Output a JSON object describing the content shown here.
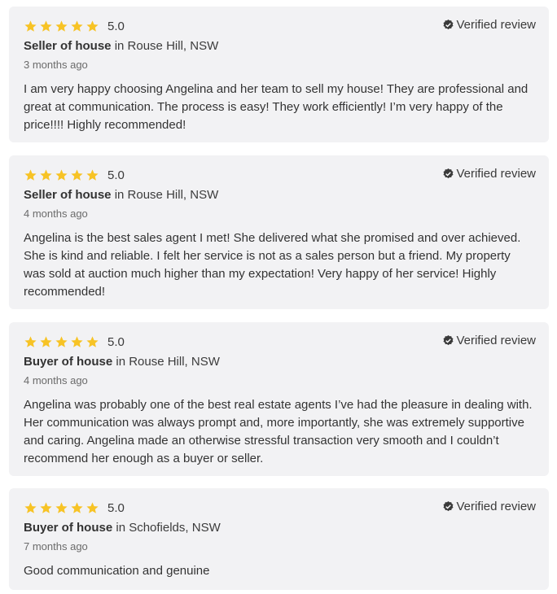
{
  "reviews": [
    {
      "rating": "5.0",
      "stars": 5,
      "verified_label": "Verified review",
      "role": "Seller of house",
      "location": " in Rouse Hill, NSW",
      "date": "3 months ago",
      "text": "I am very happy choosing Angelina and her team to sell my house! They are professional and great at communication. The process is easy! They work efficiently! I’m very happy of the price!!!! Highly recommended!"
    },
    {
      "rating": "5.0",
      "stars": 5,
      "verified_label": "Verified review",
      "role": "Seller of house",
      "location": " in Rouse Hill, NSW",
      "date": "4 months ago",
      "text": "Angelina is the best sales agent I met! She delivered what she promised and over achieved. She is kind and reliable. I felt her service is not as a sales person but a friend. My property was sold at auction much higher than my expectation! Very happy of her service! Highly recommended!"
    },
    {
      "rating": "5.0",
      "stars": 5,
      "verified_label": "Verified review",
      "role": "Buyer of house",
      "location": " in Rouse Hill, NSW",
      "date": "4 months ago",
      "text": "Angelina was probably one of the best real estate agents I’ve had the pleasure in dealing with. Her communication was always prompt and, more importantly, she was extremely supportive and caring. Angelina made an otherwise stressful transaction very smooth and I couldn’t recommend her enough as a buyer or seller."
    },
    {
      "rating": "5.0",
      "stars": 5,
      "verified_label": "Verified review",
      "role": "Buyer of house",
      "location": " in Schofields, NSW",
      "date": "7 months ago",
      "text": "Good communication and genuine"
    }
  ],
  "colors": {
    "star": "#f7c325",
    "card_bg": "#f2f2f4",
    "verified_icon": "#3a3a3a"
  },
  "icons": {
    "star": "star-icon",
    "verified": "verified-badge-icon"
  }
}
